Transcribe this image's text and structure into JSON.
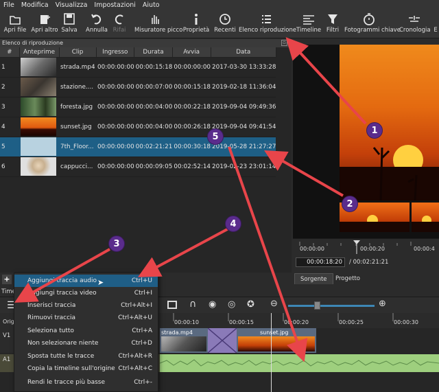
{
  "menu": [
    "File",
    "Modifica",
    "Visualizza",
    "Impostazioni",
    "Aiuto"
  ],
  "toolbar": {
    "open_file": "Apri file",
    "open_other": "Apri altro",
    "save": "Salva",
    "undo": "Annulla",
    "redo": "Rifai",
    "peak_meter": "Misuratore picco",
    "properties": "Proprietà",
    "recent": "Recenti",
    "playlist": "Elenco riproduzione",
    "timeline": "Timeline",
    "filters": "Filtri",
    "keyframes": "Fotogrammi chiave",
    "history": "Cronologia",
    "more": "E"
  },
  "playlist": {
    "title": "Elenco di riproduzione",
    "columns": [
      "#",
      "Anteprime",
      "Clip",
      "Ingresso",
      "Durata",
      "Avvia",
      "Data"
    ],
    "rows": [
      {
        "n": "1",
        "clip": "strada.mp4",
        "in": "00:00:00:00",
        "dur": "00:00:15:18",
        "start": "00:00:00:00",
        "date": "2017-03-30 13:33:28"
      },
      {
        "n": "2",
        "clip": "stazione....",
        "in": "00:00:00:00",
        "dur": "00:00:07:00",
        "start": "00:00:15:18",
        "date": "2019-02-18 11:36:04"
      },
      {
        "n": "3",
        "clip": "foresta.jpg",
        "in": "00:00:00:00",
        "dur": "00:00:04:00",
        "start": "00:00:22:18",
        "date": "2019-09-04 09:49:36"
      },
      {
        "n": "4",
        "clip": "sunset.jpg",
        "in": "00:00:00:00",
        "dur": "00:00:04:00",
        "start": "00:00:26:18",
        "date": "2019-09-04 09:41:54"
      },
      {
        "n": "5",
        "clip": "7th_Floor...",
        "in": "00:00:00:00",
        "dur": "00:02:21:21",
        "start": "00:00:30:18",
        "date": "2019-05-28 21:27:27"
      },
      {
        "n": "6",
        "clip": "cappucci...",
        "in": "00:00:00:00",
        "dur": "00:00:09:05",
        "start": "00:02:52:14",
        "date": "2019-02-23 23:01:14"
      }
    ]
  },
  "viewer": {
    "ruler_ticks": [
      "00:00:00",
      "00:00:20",
      "00:00:4"
    ],
    "current_time": "00:00:18:20",
    "total_time": "/ 00:02:21:21",
    "tab_source": "Sorgente",
    "tab_project": "Progetto"
  },
  "timeline": {
    "label": "Time",
    "orig_label": "Orig",
    "track_v1": "V1",
    "track_a1": "A1",
    "ruler_ticks": [
      "00:00:10",
      "00:00:15",
      "00:00:20",
      "00:00:25",
      "00:00:30"
    ],
    "clip1": "strada.mp4",
    "clip2": "sunset.jpg"
  },
  "context_menu": [
    {
      "label": "Aggiungi traccia audio",
      "shortcut": "Ctrl+U"
    },
    {
      "label": "Aggiungi traccia video",
      "shortcut": "Ctrl+I"
    },
    {
      "label": "Inserisci traccia",
      "shortcut": "Ctrl+Alt+I"
    },
    {
      "label": "Rimuovi traccia",
      "shortcut": "Ctrl+Alt+U"
    },
    {
      "label": "Seleziona tutto",
      "shortcut": "Ctrl+A"
    },
    {
      "label": "Non selezionare niente",
      "shortcut": "Ctrl+D"
    },
    {
      "label": "Sposta tutte le tracce",
      "shortcut": "Ctrl+Alt+R"
    },
    {
      "label": "Copia la timeline sull'origine",
      "shortcut": "Ctrl+Alt+C"
    },
    {
      "label": "Rendi le tracce più basse",
      "shortcut": "Ctrl+-"
    }
  ],
  "annotations": [
    "1",
    "2",
    "3",
    "4",
    "5"
  ],
  "colors": {
    "accent_selection": "#1e5f86",
    "badge": "#5a2c8c",
    "arrow": "#e8454a",
    "audio_wave": "#9ecf7e"
  }
}
